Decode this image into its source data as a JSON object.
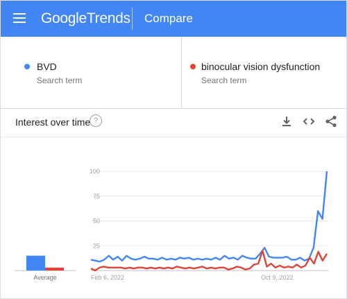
{
  "header": {
    "logo_google": "Google",
    "logo_trends": "Trends",
    "page_title": "Compare",
    "bar_color": "#4285f4"
  },
  "terms": [
    {
      "name": "BVD",
      "subtitle": "Search term",
      "color": "#4285f4"
    },
    {
      "name": "binocular vision dysfunction",
      "subtitle": "Search term",
      "color": "#db4437"
    }
  ],
  "interest_section": {
    "title": "Interest over time",
    "help_icon": "help-circle-icon",
    "tools": [
      "download-icon",
      "embed-code-icon",
      "share-icon"
    ]
  },
  "chart_data": {
    "type": "line",
    "title": "",
    "xlabel": "",
    "ylabel": "",
    "ylim": [
      0,
      100
    ],
    "yticks": [
      0,
      25,
      50,
      75,
      100
    ],
    "xtick_labels": [
      "Feb 6, 2022",
      "Oct 9, 2022"
    ],
    "grid": true,
    "average_label": "Average",
    "averages": {
      "BVD": 15,
      "binocular vision dysfunction": 3
    },
    "series": [
      {
        "name": "BVD",
        "color": "#4285f4",
        "values": [
          11,
          10,
          9,
          11,
          15,
          11,
          14,
          10,
          15,
          12,
          11,
          12,
          14,
          12,
          12,
          11,
          13,
          11,
          12,
          11,
          13,
          12,
          13,
          11,
          12,
          11,
          12,
          11,
          13,
          11,
          15,
          12,
          13,
          11,
          15,
          13,
          12,
          12,
          17,
          23,
          14,
          13,
          13,
          13,
          14,
          11,
          11,
          13,
          10,
          12,
          23,
          60,
          52,
          100
        ]
      },
      {
        "name": "binocular vision dysfunction",
        "color": "#db4437",
        "values": [
          2,
          0,
          3,
          4,
          3,
          3,
          3,
          3,
          2,
          3,
          2,
          3,
          3,
          2,
          3,
          2,
          3,
          2,
          3,
          2,
          4,
          3,
          2,
          3,
          2,
          3,
          4,
          2,
          3,
          2,
          3,
          3,
          1,
          2,
          4,
          3,
          1,
          2,
          6,
          7,
          20,
          4,
          7,
          3,
          5,
          3,
          4,
          3,
          6,
          3,
          5,
          13,
          7,
          19,
          10,
          17
        ]
      }
    ]
  }
}
